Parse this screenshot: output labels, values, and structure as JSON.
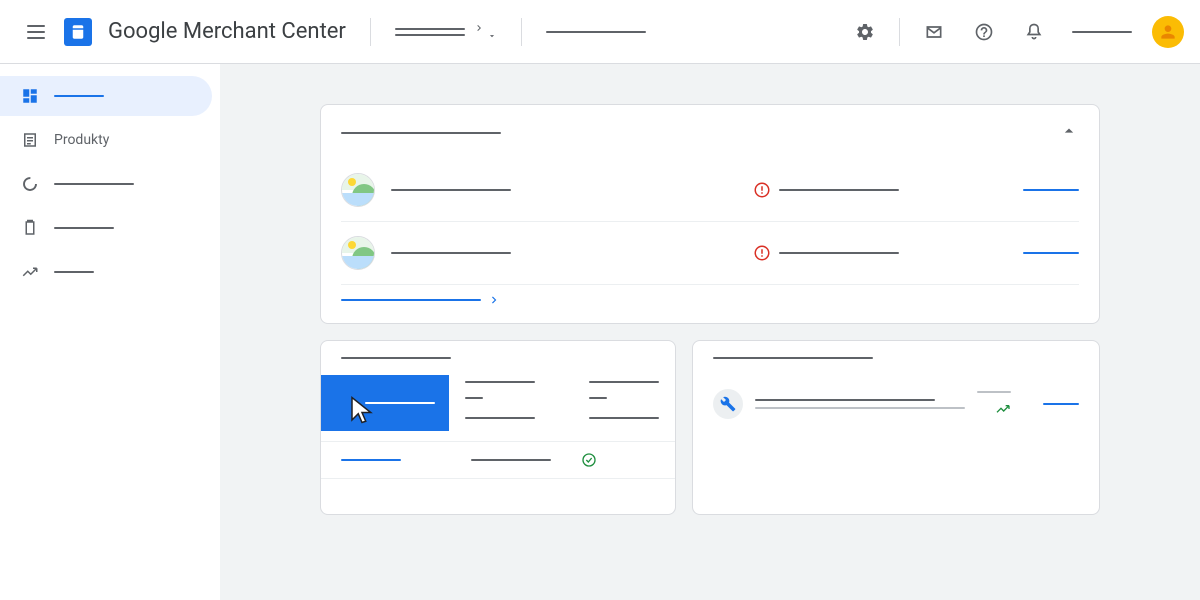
{
  "header": {
    "app_title": "Google Merchant Center"
  },
  "sidebar": {
    "items": [
      {
        "label": ""
      },
      {
        "label": "Produkty"
      },
      {
        "label": ""
      },
      {
        "label": ""
      },
      {
        "label": ""
      }
    ]
  },
  "card1": {
    "title_placeholder": "",
    "rows": [
      {
        "name": "",
        "status": ""
      },
      {
        "name": "",
        "status": ""
      }
    ]
  }
}
